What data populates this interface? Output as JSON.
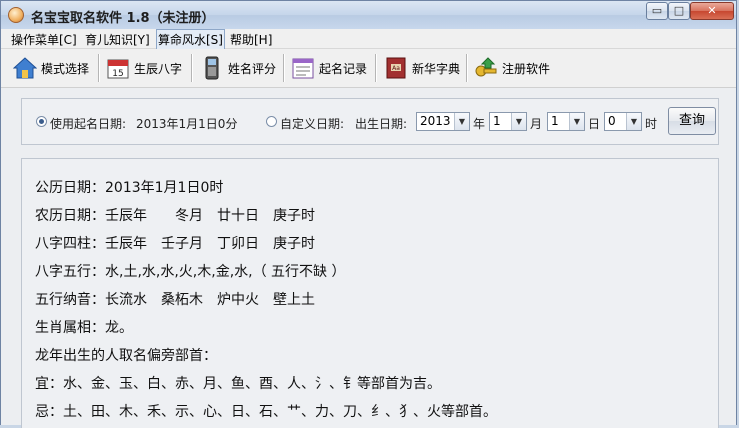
{
  "window": {
    "title": "名宝宝取名软件 1.8（未注册）",
    "controls": {
      "minimize": "▭",
      "maximize": "□",
      "close": "✕"
    }
  },
  "menu": {
    "items": [
      {
        "label": "操作菜单[C]"
      },
      {
        "label": "育儿知识[Y]"
      },
      {
        "label": "算命风水[S]"
      },
      {
        "label": "帮助[H]"
      }
    ]
  },
  "toolbar": {
    "buttons": [
      {
        "label": "模式选择",
        "icon": "home-icon"
      },
      {
        "label": "生辰八字",
        "icon": "calendar-icon"
      },
      {
        "label": "姓名评分",
        "icon": "phone-icon"
      },
      {
        "label": "起名记录",
        "icon": "notes-icon"
      },
      {
        "label": "新华字典",
        "icon": "dictionary-icon"
      },
      {
        "label": "注册软件",
        "icon": "key-icon"
      }
    ]
  },
  "query": {
    "use_naming_date_label": "使用起名日期:",
    "use_naming_date_value": "2013年1月1日0分",
    "custom_date_label": "自定义日期:",
    "birth_date_label": "出生日期:",
    "year_value": "2013",
    "year_unit": "年",
    "month_value": "1",
    "month_unit": "月",
    "day_value": "1",
    "day_unit": "日",
    "hour_value": "0",
    "hour_unit": "时",
    "query_button": "查询",
    "mode": "use_naming_date"
  },
  "result": {
    "lines": [
      "公历日期：2013年1月1日0时",
      "农历日期：壬辰年　　冬月　廿十日　庚子时",
      "八字四柱：壬辰年　壬子月　丁卯日　庚子时",
      "八字五行：水,土,水,水,火,木,金,水,（ 五行不缺 ）",
      "五行纳音：长流水　桑柘木　炉中火　壁上土",
      "生肖属相：龙。",
      "龙年出生的人取名偏旁部首：",
      "宜：水、金、玉、白、赤、月、鱼、酉、人、氵、钅等部首为吉。",
      "忌：土、田、木、禾、示、心、日、石、艹、力、刀、纟、犭、火等部首。"
    ]
  },
  "colors": {
    "title_bar": "#c5d5ea",
    "close_button": "#c74730",
    "panel_border": "#bfc6d0"
  }
}
